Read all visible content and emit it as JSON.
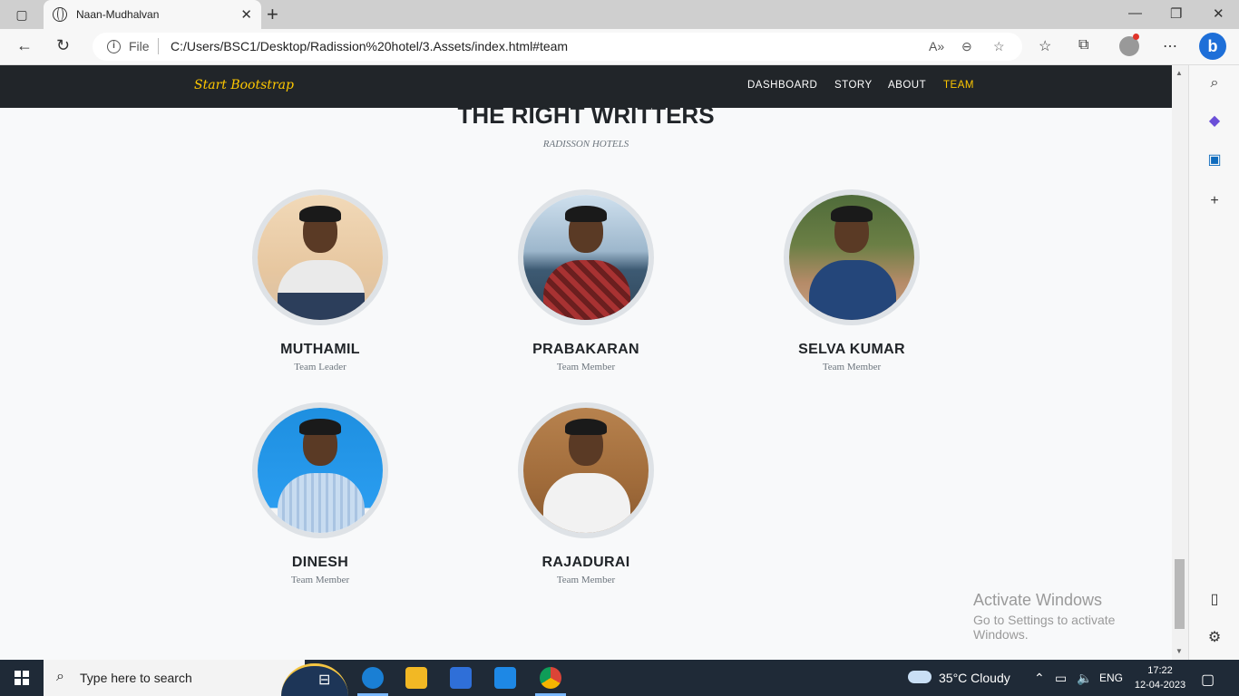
{
  "browser": {
    "tab_title": "Naan-Mudhalvan",
    "url_scheme_label": "File",
    "url": "C:/Users/BSC1/Desktop/Radission%20hotel/3.Assets/index.html#team"
  },
  "site": {
    "brand": "Start Bootstrap",
    "nav": [
      {
        "label": "DASHBOARD",
        "active": false
      },
      {
        "label": "STORY",
        "active": false
      },
      {
        "label": "ABOUT",
        "active": false
      },
      {
        "label": "TEAM",
        "active": true
      }
    ],
    "accent_color": "#ffc800",
    "nav_bg": "#212529"
  },
  "team_section": {
    "heading": "THE RIGHT WRITTERS",
    "subheading": "RADISSON HOTELS",
    "members": [
      {
        "name": "MUTHAMIL",
        "role": "Team Leader"
      },
      {
        "name": "PRABAKARAN",
        "role": "Team Member"
      },
      {
        "name": "SELVA KUMAR",
        "role": "Team Member"
      },
      {
        "name": "DINESH",
        "role": "Team Member"
      },
      {
        "name": "RAJADURAI",
        "role": "Team Member"
      }
    ]
  },
  "watermark": {
    "line1": "Activate Windows",
    "line2": "Go to Settings to activate Windows."
  },
  "taskbar": {
    "search_placeholder": "Type here to search",
    "weather": "35°C  Cloudy",
    "language": "ENG",
    "time": "17:22",
    "date": "12-04-2023"
  }
}
